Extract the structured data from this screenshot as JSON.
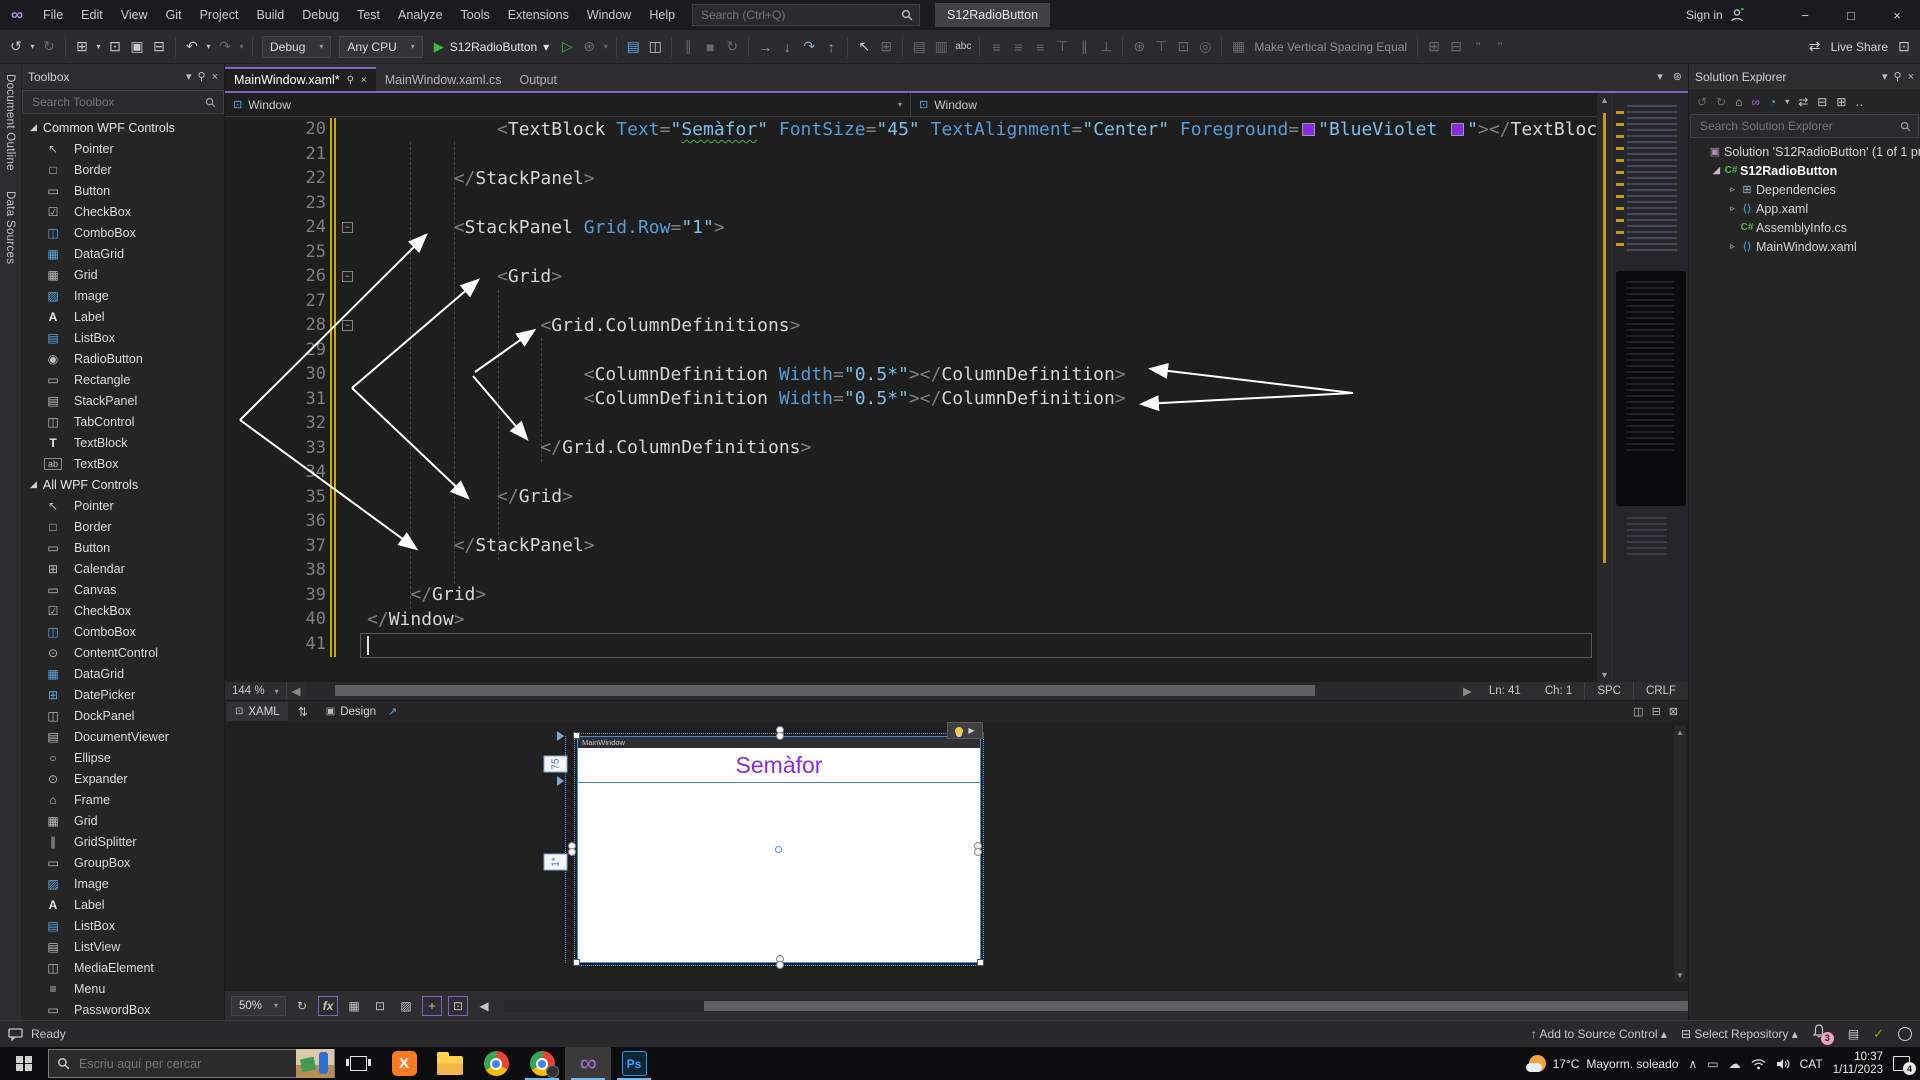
{
  "titlebar": {
    "menus": [
      "File",
      "Edit",
      "View",
      "Git",
      "Project",
      "Build",
      "Debug",
      "Test",
      "Analyze",
      "Tools",
      "Extensions",
      "Window",
      "Help"
    ],
    "search_placeholder": "Search (Ctrl+Q)",
    "window_title": "S12RadioButton",
    "sign_in": "Sign in",
    "controls": {
      "minimize": "−",
      "restore": "□",
      "close": "×"
    }
  },
  "toolbar": {
    "config": "Debug",
    "platform": "Any CPU",
    "run_target": "S12RadioButton",
    "make_vertical_spacing": "Make Vertical Spacing Equal",
    "live_share": "Live Share",
    "items": [
      {
        "k": "i",
        "g": "↺",
        "n": "navigate-backward-icon"
      },
      {
        "k": "i",
        "g": "▾",
        "n": "navigate-backward-menu-icon",
        "sm": 1
      },
      {
        "k": "i",
        "g": "↻",
        "n": "navigate-forward-icon",
        "d": 1
      },
      {
        "k": "s"
      },
      {
        "k": "i",
        "g": "⊞",
        "n": "new-project-icon"
      },
      {
        "k": "i",
        "g": "▾",
        "n": "new-project-menu-icon",
        "sm": 1
      },
      {
        "k": "i",
        "g": "⊡",
        "n": "open-file-icon"
      },
      {
        "k": "i",
        "g": "▣",
        "n": "save-icon"
      },
      {
        "k": "i",
        "g": "⊟",
        "n": "save-all-icon"
      },
      {
        "k": "s"
      },
      {
        "k": "i",
        "g": "↶",
        "n": "undo-icon"
      },
      {
        "k": "i",
        "g": "▾",
        "n": "undo-menu-icon",
        "sm": 1
      },
      {
        "k": "i",
        "g": "↷",
        "n": "redo-icon",
        "d": 1
      },
      {
        "k": "i",
        "g": "▾",
        "n": "redo-menu-icon",
        "sm": 1,
        "d": 1
      },
      {
        "k": "s"
      },
      {
        "k": "c",
        "bind": "config",
        "n": "solution-configuration-dropdown"
      },
      {
        "k": "c",
        "bind": "platform",
        "n": "solution-platform-dropdown"
      },
      {
        "k": "r"
      },
      {
        "k": "i",
        "g": "▷",
        "n": "start-without-debugging-icon",
        "c": "#3ebb3e"
      },
      {
        "k": "i",
        "g": "⊛",
        "n": "hot-reload-icon",
        "d": 1
      },
      {
        "k": "i",
        "g": "▾",
        "n": "hot-reload-menu-icon",
        "sm": 1,
        "d": 1
      },
      {
        "k": "s"
      },
      {
        "k": "i",
        "g": "▤",
        "n": "add-item-icon",
        "c": "#5ba7e0"
      },
      {
        "k": "i",
        "g": "◫",
        "n": "window-layout-icon"
      },
      {
        "k": "s"
      },
      {
        "k": "i",
        "g": "∥",
        "n": "pause-icon",
        "d": 1
      },
      {
        "k": "i",
        "g": "■",
        "n": "stop-icon",
        "d": 1
      },
      {
        "k": "i",
        "g": "↻",
        "n": "restart-icon",
        "d": 1
      },
      {
        "k": "s"
      },
      {
        "k": "i",
        "g": "→",
        "n": "show-next-statement-icon",
        "c": "#7fa8c8"
      },
      {
        "k": "i",
        "g": "↓",
        "n": "step-into-icon",
        "c": "#7fa8c8"
      },
      {
        "k": "i",
        "g": "↷",
        "n": "step-over-icon",
        "c": "#7fa8c8"
      },
      {
        "k": "i",
        "g": "↑",
        "n": "step-out-icon",
        "c": "#7fa8c8"
      },
      {
        "k": "s"
      },
      {
        "k": "i",
        "g": "↖",
        "n": "designer-pointer-icon"
      },
      {
        "k": "i",
        "g": "⊞",
        "n": "designer-grid-icon",
        "d": 1
      },
      {
        "k": "s"
      },
      {
        "k": "i",
        "g": "▤",
        "n": "align-lefts-icon",
        "d": 1
      },
      {
        "k": "i",
        "g": "▥",
        "n": "align-centers-icon",
        "d": 1
      },
      {
        "k": "i",
        "g": "abc",
        "n": "spell-check-icon",
        "txt": 1
      },
      {
        "k": "s"
      },
      {
        "k": "i",
        "g": "≡",
        "n": "align-left-edges-icon",
        "d": 1
      },
      {
        "k": "i",
        "g": "≡",
        "n": "align-horizontal-centers-icon",
        "d": 1
      },
      {
        "k": "i",
        "g": "≡",
        "n": "align-right-edges-icon",
        "d": 1
      },
      {
        "k": "i",
        "g": "⊤",
        "n": "align-tops-icon",
        "d": 1
      },
      {
        "k": "i",
        "g": "∥",
        "n": "align-middles-icon",
        "d": 1
      },
      {
        "k": "i",
        "g": "⊥",
        "n": "align-bottoms-icon",
        "d": 1
      },
      {
        "k": "s"
      },
      {
        "k": "i",
        "g": "⊛",
        "n": "snap-to-grid-icon",
        "d": 1
      },
      {
        "k": "i",
        "g": "⊤",
        "n": "pin-icon",
        "d": 1
      },
      {
        "k": "i",
        "g": "⊡",
        "n": "fit-selection-icon",
        "d": 1
      },
      {
        "k": "i",
        "g": "◎",
        "n": "zoom-selection-icon",
        "d": 1
      },
      {
        "k": "s"
      },
      {
        "k": "i",
        "g": "▦",
        "n": "spacing-icon",
        "d": 1
      },
      {
        "k": "t",
        "bind": "make_vertical_spacing",
        "n": "make-vertical-spacing-label"
      },
      {
        "k": "s"
      },
      {
        "k": "i",
        "g": "⊞",
        "n": "edit-style-icon",
        "d": 1
      },
      {
        "k": "i",
        "g": "⊟",
        "n": "edit-template-icon",
        "d": 1
      },
      {
        "k": "i",
        "g": "”",
        "n": "comment-icon",
        "d": 1
      },
      {
        "k": "i",
        "g": "”",
        "n": "uncomment-icon",
        "d": 1
      },
      {
        "k": "sp"
      },
      {
        "k": "i",
        "g": "⇄",
        "n": "live-share-icon"
      },
      {
        "k": "t",
        "bind": "live_share",
        "n": "live-share-label",
        "lit": 1
      },
      {
        "k": "i",
        "g": "⊡",
        "n": "feedback-icon"
      }
    ]
  },
  "side_tabs": [
    "Document Outline",
    "Data Sources"
  ],
  "toolbox": {
    "title": "Toolbox",
    "search_placeholder": "Search Toolbox",
    "sections": [
      {
        "label": "Common WPF Controls",
        "items": [
          {
            "l": "Pointer",
            "g": "↖"
          },
          {
            "l": "Border",
            "g": "□"
          },
          {
            "l": "Button",
            "g": "▭"
          },
          {
            "l": "CheckBox",
            "g": "☑"
          },
          {
            "l": "ComboBox",
            "g": "◫",
            "c": "#5ba7e0"
          },
          {
            "l": "DataGrid",
            "g": "▦",
            "c": "#5ba7e0"
          },
          {
            "l": "Grid",
            "g": "▦"
          },
          {
            "l": "Image",
            "g": "▨",
            "c": "#5ba7e0"
          },
          {
            "l": "Label",
            "g": "A"
          },
          {
            "l": "ListBox",
            "g": "▤",
            "c": "#5ba7e0"
          },
          {
            "l": "RadioButton",
            "g": "◉"
          },
          {
            "l": "Rectangle",
            "g": "▭"
          },
          {
            "l": "StackPanel",
            "g": "▤"
          },
          {
            "l": "TabControl",
            "g": "◫"
          },
          {
            "l": "TextBlock",
            "g": "T"
          },
          {
            "l": "TextBox",
            "g": "ab"
          }
        ]
      },
      {
        "label": "All WPF Controls",
        "items": [
          {
            "l": "Pointer",
            "g": "↖"
          },
          {
            "l": "Border",
            "g": "□"
          },
          {
            "l": "Button",
            "g": "▭"
          },
          {
            "l": "Calendar",
            "g": "⊞"
          },
          {
            "l": "Canvas",
            "g": "▭"
          },
          {
            "l": "CheckBox",
            "g": "☑"
          },
          {
            "l": "ComboBox",
            "g": "◫",
            "c": "#5ba7e0"
          },
          {
            "l": "ContentControl",
            "g": "⊙"
          },
          {
            "l": "DataGrid",
            "g": "▦",
            "c": "#5ba7e0"
          },
          {
            "l": "DatePicker",
            "g": "⊞",
            "c": "#5ba7e0"
          },
          {
            "l": "DockPanel",
            "g": "◫"
          },
          {
            "l": "DocumentViewer",
            "g": "▤"
          },
          {
            "l": "Ellipse",
            "g": "○"
          },
          {
            "l": "Expander",
            "g": "⊙"
          },
          {
            "l": "Frame",
            "g": "⌂"
          },
          {
            "l": "Grid",
            "g": "▦"
          },
          {
            "l": "GridSplitter",
            "g": "∥"
          },
          {
            "l": "GroupBox",
            "g": "▭"
          },
          {
            "l": "Image",
            "g": "▨",
            "c": "#5ba7e0"
          },
          {
            "l": "Label",
            "g": "A"
          },
          {
            "l": "ListBox",
            "g": "▤",
            "c": "#5ba7e0"
          },
          {
            "l": "ListView",
            "g": "▤"
          },
          {
            "l": "MediaElement",
            "g": "◫"
          },
          {
            "l": "Menu",
            "g": "≡"
          },
          {
            "l": "PasswordBox",
            "g": "▭"
          }
        ]
      }
    ]
  },
  "tabs": [
    {
      "label": "MainWindow.xaml*",
      "active": true
    },
    {
      "label": "MainWindow.xaml.cs",
      "active": false
    },
    {
      "label": "Output",
      "active": false
    }
  ],
  "breadcrumb": {
    "left": "Window",
    "right": "Window"
  },
  "editor": {
    "zoom": "144 %",
    "status": {
      "line": "Ln: 41",
      "col": "Ch: 1",
      "spaces": "SPC",
      "eol": "CRLF"
    },
    "xaml_tab": "XAML",
    "design_tab": "Design",
    "folds": [
      24,
      26,
      28
    ],
    "lines": [
      {
        "n": 20,
        "t": [
          [
            "w",
            "            "
          ],
          [
            "p",
            "<"
          ],
          [
            "el",
            "TextBlock"
          ],
          [
            "w",
            " "
          ],
          [
            "at",
            "Text"
          ],
          [
            "p",
            "="
          ],
          [
            "vq",
            "\""
          ],
          [
            "sq",
            "Semàfor"
          ],
          [
            "vq",
            "\""
          ],
          [
            "w",
            " "
          ],
          [
            "at",
            "FontSize"
          ],
          [
            "p",
            "="
          ],
          [
            "vq",
            "\"45\""
          ],
          [
            "w",
            " "
          ],
          [
            "at",
            "TextAlignment"
          ],
          [
            "p",
            "="
          ],
          [
            "vq",
            "\"Center\""
          ],
          [
            "w",
            " "
          ],
          [
            "at",
            "Foreground"
          ],
          [
            "p",
            "="
          ],
          [
            "sw",
            ""
          ],
          [
            "vq",
            "\"BlueViolet "
          ],
          [
            "sw",
            ""
          ],
          [
            "vq",
            "\""
          ],
          [
            "p",
            "></"
          ],
          [
            "el",
            "TextBlock"
          ]
        ]
      },
      {
        "n": 21,
        "t": []
      },
      {
        "n": 22,
        "t": [
          [
            "w",
            "        "
          ],
          [
            "p",
            "</"
          ],
          [
            "el",
            "StackPanel"
          ],
          [
            "p",
            ">"
          ]
        ]
      },
      {
        "n": 23,
        "t": []
      },
      {
        "n": 24,
        "t": [
          [
            "w",
            "        "
          ],
          [
            "p",
            "<"
          ],
          [
            "el",
            "StackPanel"
          ],
          [
            "w",
            " "
          ],
          [
            "at",
            "Grid.Row"
          ],
          [
            "p",
            "="
          ],
          [
            "vq",
            "\"1\""
          ],
          [
            "p",
            ">"
          ]
        ]
      },
      {
        "n": 25,
        "t": []
      },
      {
        "n": 26,
        "t": [
          [
            "w",
            "            "
          ],
          [
            "p",
            "<"
          ],
          [
            "el",
            "Grid"
          ],
          [
            "p",
            ">"
          ]
        ]
      },
      {
        "n": 27,
        "t": []
      },
      {
        "n": 28,
        "t": [
          [
            "w",
            "                "
          ],
          [
            "p",
            "<"
          ],
          [
            "el",
            "Grid.ColumnDefinitions"
          ],
          [
            "p",
            ">"
          ]
        ]
      },
      {
        "n": 29,
        "t": []
      },
      {
        "n": 30,
        "t": [
          [
            "w",
            "                    "
          ],
          [
            "p",
            "<"
          ],
          [
            "el",
            "ColumnDefinition"
          ],
          [
            "w",
            " "
          ],
          [
            "at",
            "Width"
          ],
          [
            "p",
            "="
          ],
          [
            "vq",
            "\"0.5*\""
          ],
          [
            "p",
            "></"
          ],
          [
            "el",
            "ColumnDefinition"
          ],
          [
            "p",
            ">"
          ]
        ]
      },
      {
        "n": 31,
        "t": [
          [
            "w",
            "                    "
          ],
          [
            "p",
            "<"
          ],
          [
            "el",
            "ColumnDefinition"
          ],
          [
            "w",
            " "
          ],
          [
            "at",
            "Width"
          ],
          [
            "p",
            "="
          ],
          [
            "vq",
            "\"0.5*\""
          ],
          [
            "p",
            "></"
          ],
          [
            "el",
            "ColumnDefinition"
          ],
          [
            "p",
            ">"
          ]
        ]
      },
      {
        "n": 32,
        "t": []
      },
      {
        "n": 33,
        "t": [
          [
            "w",
            "                "
          ],
          [
            "p",
            "</"
          ],
          [
            "el",
            "Grid.ColumnDefinitions"
          ],
          [
            "p",
            ">"
          ]
        ]
      },
      {
        "n": 34,
        "t": []
      },
      {
        "n": 35,
        "t": [
          [
            "w",
            "            "
          ],
          [
            "p",
            "</"
          ],
          [
            "el",
            "Grid"
          ],
          [
            "p",
            ">"
          ]
        ]
      },
      {
        "n": 36,
        "t": []
      },
      {
        "n": 37,
        "t": [
          [
            "w",
            "        "
          ],
          [
            "p",
            "</"
          ],
          [
            "el",
            "StackPanel"
          ],
          [
            "p",
            ">"
          ]
        ]
      },
      {
        "n": 38,
        "t": []
      },
      {
        "n": 39,
        "t": [
          [
            "w",
            "    "
          ],
          [
            "p",
            "</"
          ],
          [
            "el",
            "Grid"
          ],
          [
            "p",
            ">"
          ]
        ]
      },
      {
        "n": 40,
        "t": [
          [
            "p",
            "</"
          ],
          [
            "el",
            "Window"
          ],
          [
            "p",
            ">"
          ]
        ]
      },
      {
        "n": 41,
        "t": []
      }
    ]
  },
  "annotations": {
    "arrows": [
      [
        15,
        356,
        200,
        172
      ],
      [
        15,
        356,
        190,
        484
      ],
      [
        127,
        324,
        252,
        217
      ],
      [
        127,
        324,
        242,
        433
      ],
      [
        250,
        308,
        308,
        267
      ],
      [
        248,
        312,
        301,
        374
      ],
      [
        1128,
        329,
        927,
        305
      ],
      [
        1128,
        329,
        918,
        340
      ]
    ]
  },
  "design": {
    "zoom": "50%",
    "artboard_title": "MainWindow",
    "heading": "Semàfor",
    "heading_color": "#8a2be2",
    "row_size_label": "75",
    "row_star_label": "1*"
  },
  "solution_explorer": {
    "title": "Solution Explorer",
    "search_placeholder": "Search Solution Explorer",
    "items": [
      {
        "indent": 0,
        "exp": "",
        "kind": "sln",
        "label": "Solution 'S12RadioButton' (1 of 1 pr",
        "bold": false
      },
      {
        "indent": 1,
        "exp": "x",
        "kind": "csproj",
        "label": "S12RadioButton",
        "bold": true
      },
      {
        "indent": 2,
        "exp": "c",
        "kind": "dep",
        "label": "Dependencies",
        "bold": false
      },
      {
        "indent": 2,
        "exp": "c",
        "kind": "xaml",
        "label": "App.xaml",
        "bold": false
      },
      {
        "indent": 2,
        "exp": "",
        "kind": "cs",
        "label": "AssemblyInfo.cs",
        "bold": false
      },
      {
        "indent": 2,
        "exp": "c",
        "kind": "xaml",
        "label": "MainWindow.xaml",
        "bold": false
      }
    ]
  },
  "status_bar": {
    "ready": "Ready",
    "add_source": "Add to Source Control",
    "select_repo": "Select Repository",
    "bell_badge": "3"
  },
  "taskbar": {
    "search_placeholder": "Escriu aquí per cercar",
    "weather_temp": "17°C",
    "weather_desc": "Mayorm. soleado",
    "lang": "CAT",
    "time": "10:37",
    "date": "1/11/2023",
    "notif_badge": "4"
  },
  "colors": {
    "accent_purple": "#8661c5",
    "blueviolet": "#8a2be2",
    "run_green": "#3ebb3e",
    "gold_change_bar": "#d0a800"
  }
}
